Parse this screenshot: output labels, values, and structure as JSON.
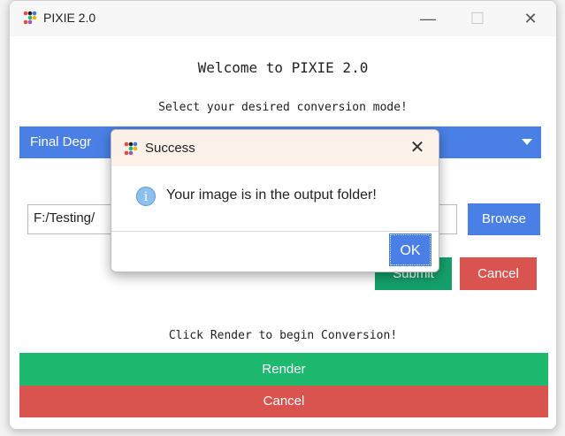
{
  "window": {
    "title": "PIXIE 2.0",
    "controls": {
      "minimize": "—",
      "maximize": "☐",
      "close": "✕"
    }
  },
  "main": {
    "welcome": "Welcome to PIXIE 2.0",
    "select_prompt": "Select your desired conversion mode!",
    "mode_select_value": "Final Degr",
    "path_value": "F:/Testing/",
    "browse_label": "Browse",
    "submit_label": "Submit",
    "cancel_label": "Cancel",
    "render_prompt": "Click Render to begin Conversion!",
    "render_label": "Render",
    "cancel_bar_label": "Cancel"
  },
  "dialog": {
    "title": "Success",
    "close": "✕",
    "info_icon": "i",
    "message": "Your image is in the output folder!",
    "ok_label": "OK"
  },
  "colors": {
    "primary_blue": "#4a80e6",
    "green": "#1cb96f",
    "red": "#d9534f"
  },
  "icons": [
    "app-logo-icon",
    "info-icon",
    "dropdown-arrow-icon",
    "close-icon"
  ]
}
